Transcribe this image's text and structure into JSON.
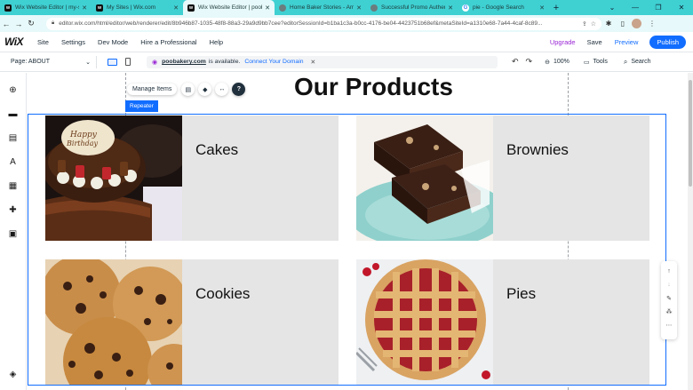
{
  "browser": {
    "tabs": [
      {
        "title": "Wix Website Editor | my-si...",
        "icon": "wix-icon",
        "active": false
      },
      {
        "title": "My Sites | Wix.com",
        "icon": "wix-icon",
        "active": false
      },
      {
        "title": "Wix Website Editor | poob...",
        "icon": "wix-icon",
        "active": true
      },
      {
        "title": "Home Baker Stories - Amaz...",
        "icon": "globe-icon",
        "active": false
      },
      {
        "title": "Successful Promo Authenti...",
        "icon": "globe-icon",
        "active": false
      },
      {
        "title": "pie - Google Search",
        "icon": "google-icon",
        "active": false
      }
    ],
    "new_tab": "+",
    "url": "editor.wix.com/html/editor/web/renderer/edit/8b946b87-1035-48f8-88a3-29a9d9bb7cee?editorSessionId=b1ba1c3a-b0cc-4176-be04-4423751b68ef&metaSiteId=a1310e68-7a44-4caf-8c89..."
  },
  "wix_top": {
    "logo": "WiX",
    "menu": [
      "Site",
      "Settings",
      "Dev Mode",
      "Hire a Professional",
      "Help"
    ],
    "upgrade": "Upgrade",
    "save": "Save",
    "preview": "Preview",
    "publish": "Publish"
  },
  "secondary": {
    "page": "Page: ABOUT",
    "domain": "poobakery.com",
    "domain_suffix": "is available.",
    "connect": "Connect Your Domain",
    "zoom": "100%",
    "tools": "Tools",
    "search": "Search"
  },
  "canvas": {
    "title": "Our Products",
    "manage_items": "Manage Items",
    "repeater_tag": "Repeater",
    "items": [
      {
        "label": "Cakes",
        "image": "birthday-cake-image"
      },
      {
        "label": "Brownies",
        "image": "brownies-image"
      },
      {
        "label": "Cookies",
        "image": "cookies-image"
      },
      {
        "label": "Pies",
        "image": "cherry-pie-image"
      }
    ]
  },
  "colors": {
    "tab_strip": "#3fd0d2",
    "wix_blue": "#116dff",
    "upgrade_purple": "#9a27d5",
    "card_bg": "#e5e5e5"
  }
}
